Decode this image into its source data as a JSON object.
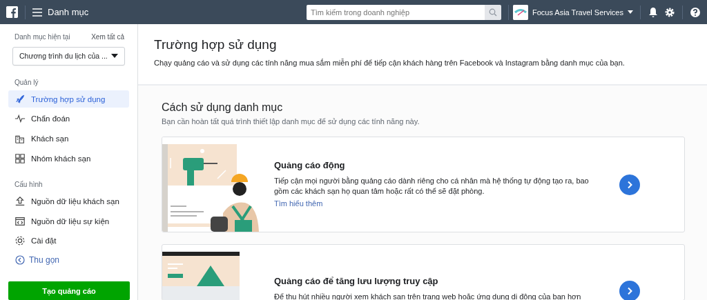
{
  "topbar": {
    "title": "Danh mục",
    "search": {
      "placeholder": "Tìm kiếm trong doanh nghiệp"
    },
    "account": {
      "name": "Focus Asia Travel Services"
    }
  },
  "sidebar": {
    "current_label": "Danh mục hiện tại",
    "view_all": "Xem tất cả",
    "dropdown": {
      "value": "Chương trình du lịch của ..."
    },
    "sections": [
      {
        "label": "Quản lý",
        "items": [
          {
            "label": "Trường hợp sử dụng",
            "selected": true
          },
          {
            "label": "Chẩn đoán",
            "selected": false
          },
          {
            "label": "Khách sạn",
            "selected": false
          },
          {
            "label": "Nhóm khách sạn",
            "selected": false
          }
        ]
      },
      {
        "label": "Cấu hình",
        "items": [
          {
            "label": "Nguồn dữ liệu khách sạn",
            "selected": false
          },
          {
            "label": "Nguồn dữ liệu sự kiện",
            "selected": false
          },
          {
            "label": "Cài đặt",
            "selected": false
          }
        ]
      }
    ],
    "collapse": "Thu gọn",
    "create_button": "Tạo quảng cáo"
  },
  "main": {
    "title": "Trường hợp sử dụng",
    "subtitle": "Chạy quảng cáo và sử dụng các tính năng mua sắm miễn phí để tiếp cận khách hàng trên Facebook và Instagram bằng danh mục của bạn.",
    "section": {
      "title": "Cách sử dụng danh mục",
      "subtitle": "Bạn cần hoàn tất quá trình thiết lập danh mục để sử dụng các tính năng này."
    },
    "cards": [
      {
        "kind": "dynamic",
        "title": "Quảng cáo động",
        "description": "Tiếp cận mọi người bằng quảng cáo dành riêng cho cá nhân mà hệ thống tự động tạo ra, bao gồm các khách sạn họ quan tâm hoặc rất có thể sẽ đặt phòng.",
        "link": "Tìm hiểu thêm"
      },
      {
        "kind": "traffic",
        "title": "Quảng cáo để tăng lưu lượng truy cập",
        "description": "Để thu hút nhiều người xem khách sạn trên trang web hoặc ứng dụng di động của bạn hơn"
      }
    ]
  }
}
